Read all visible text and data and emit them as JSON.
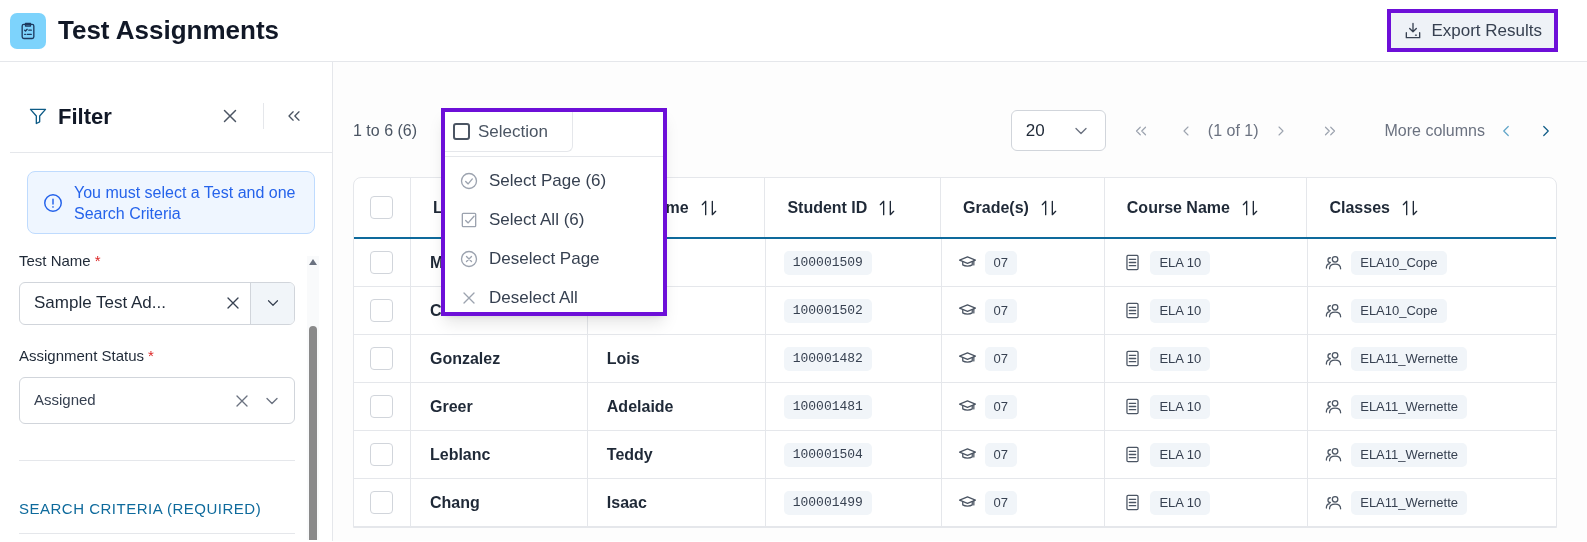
{
  "page": {
    "title": "Test Assignments",
    "export_button": "Export Results"
  },
  "filter": {
    "title": "Filter",
    "notice": "You must select a Test and one Search Criteria",
    "fields": [
      {
        "kind": "combo",
        "label": "Test Name",
        "required_mark": "*",
        "value": "Sample Test Ad..."
      },
      {
        "kind": "select",
        "label": "Assignment Status",
        "required_mark": "*",
        "value": "Assigned"
      }
    ],
    "section": "SEARCH CRITERIA (REQUIRED)"
  },
  "toolbar": {
    "range": "1 to 6 (6)",
    "selection_button": {
      "label": "Selection",
      "checked": false
    },
    "page_size": "20",
    "page_info": "(1 of 1)",
    "more_columns": "More columns"
  },
  "selection_menu": [
    {
      "kind": "check-circle",
      "label": "Select Page (6)"
    },
    {
      "kind": "check-square",
      "label": "Select All (6)"
    },
    {
      "kind": "x-circle",
      "label": "Deselect Page"
    },
    {
      "kind": "x",
      "label": "Deselect All"
    }
  ],
  "table": {
    "header_checked": false,
    "columns": [
      {
        "label": "L"
      },
      {
        "label": "me"
      },
      {
        "label": "Student ID"
      },
      {
        "label": "Grade(s)"
      },
      {
        "label": "Course Name"
      },
      {
        "label": "Classes"
      }
    ],
    "rows": [
      {
        "selected": false,
        "last_name": "M",
        "student_id": "100001509",
        "grade": "07",
        "course": "ELA 10",
        "class": "ELA10_Cope"
      },
      {
        "selected": false,
        "last_name": "C",
        "student_id": "100001502",
        "grade": "07",
        "course": "ELA 10",
        "class": "ELA10_Cope"
      },
      {
        "selected": false,
        "last_name": "Gonzalez",
        "first_name": "Lois",
        "student_id": "100001482",
        "grade": "07",
        "course": "ELA 10",
        "class": "ELA11_Wernette"
      },
      {
        "selected": false,
        "last_name": "Greer",
        "first_name": "Adelaide",
        "student_id": "100001481",
        "grade": "07",
        "course": "ELA 10",
        "class": "ELA11_Wernette"
      },
      {
        "selected": false,
        "last_name": "Leblanc",
        "first_name": "Teddy",
        "student_id": "100001504",
        "grade": "07",
        "course": "ELA 10",
        "class": "ELA11_Wernette"
      },
      {
        "selected": false,
        "last_name": "Chang",
        "first_name": "Isaac",
        "student_id": "100001499",
        "grade": "07",
        "course": "ELA 10",
        "class": "ELA11_Wernette"
      }
    ]
  }
}
